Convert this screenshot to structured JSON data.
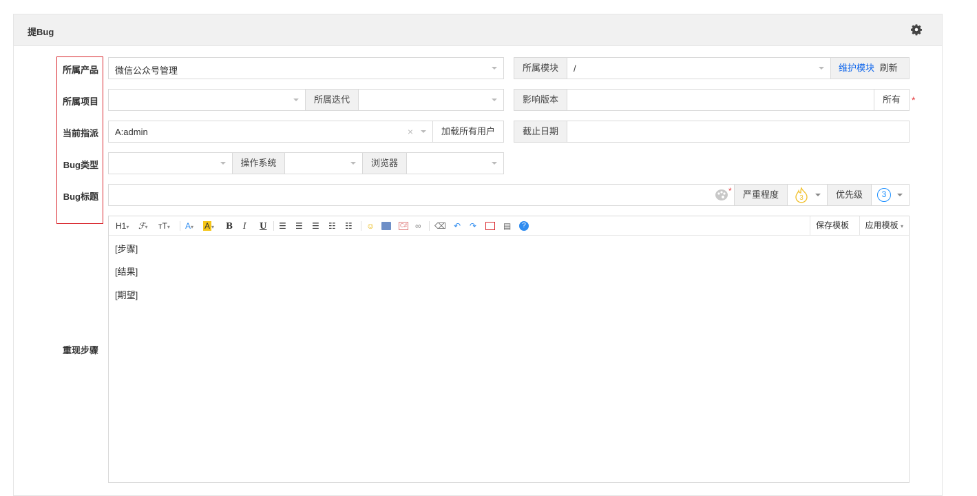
{
  "panel": {
    "title": "提Bug"
  },
  "labels": {
    "product": "所属产品",
    "project": "所属项目",
    "assign": "当前指派",
    "type": "Bug类型",
    "title": "Bug标题",
    "steps": "重现步骤"
  },
  "product": {
    "value": "微信公众号管理"
  },
  "module": {
    "label": "所属模块",
    "value": "/",
    "maintain": "维护模块",
    "refresh": "刷新"
  },
  "iteration": {
    "label": "所属迭代"
  },
  "version": {
    "label": "影响版本",
    "all": "所有",
    "required_mark": "*"
  },
  "assign": {
    "value": "A:admin",
    "clear": "×",
    "load_all": "加载所有用户"
  },
  "deadline": {
    "label": "截止日期"
  },
  "os": {
    "label": "操作系统"
  },
  "browser": {
    "label": "浏览器"
  },
  "title_row": {
    "required_mark": "*",
    "severity_label": "严重程度",
    "severity_value": "3",
    "priority_label": "优先级",
    "priority_value": "3"
  },
  "editor": {
    "toolbar": {
      "h1": "H1",
      "font": "ℱ",
      "size": "тT",
      "font_color": "A",
      "bg_color": "A",
      "bold": "B",
      "italic": "I",
      "underline": "U",
      "save_template": "保存模板",
      "apply_template": "应用模板"
    },
    "lines": [
      "[步骤]",
      "[结果]",
      "[期望]"
    ]
  },
  "colors": {
    "accent": "#0c64eb",
    "required": "#e4393c",
    "highlight_box": "#d9262c",
    "severity": "#f1c232",
    "priority": "#1e90ff"
  }
}
